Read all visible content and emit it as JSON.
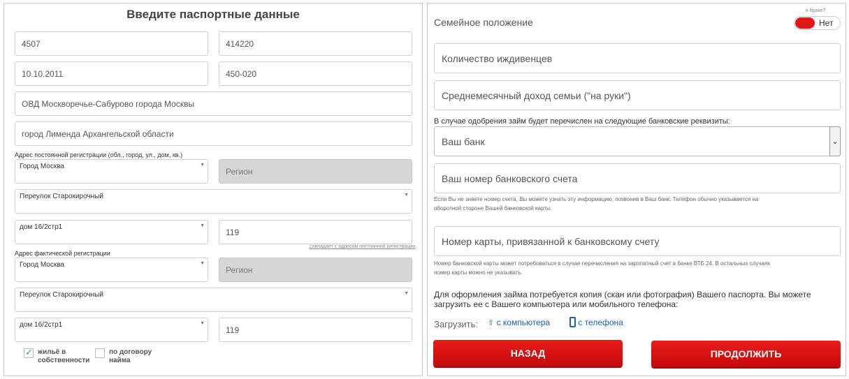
{
  "passport": {
    "title": "Введите паспортные данные",
    "series": "4507",
    "number": "414220",
    "issue_date": "10.10.2011",
    "division_code": "450-020",
    "issued_by": "ОВД Москворечье-Сабурово города Москвы",
    "birth_place": "город Лименда Архангельской области"
  },
  "permanent_address": {
    "label": "Адрес постоянной регистрации (обл., город, ул., дом, кв.)",
    "city": "Город Москва",
    "region_placeholder": "Регион",
    "street": "Переулок Старокирочный",
    "house": "дом 16/2стр1",
    "index": "119",
    "same_address_link": "совпадает с адресом постоянной регистрации"
  },
  "actual_address": {
    "label": "Адрес фактической регистрации",
    "city": "Город Москва",
    "region_placeholder": "Регион",
    "street": "Переулок Старокирочный",
    "house": "дом 16/2стр1",
    "index": "119"
  },
  "housing": {
    "owned_label_1": "жильё в",
    "owned_label_2": "собственности",
    "owned_checked": true,
    "lease_label_1": "по договору",
    "lease_label_2": "найма",
    "lease_checked": false
  },
  "family": {
    "label": "Семейное положение",
    "married_caption": "в браке?",
    "married_value": "Нет",
    "dependents_placeholder": "Количество иждивенцев",
    "income_placeholder": "Среднемесячный доход семьи (\"на руки\")"
  },
  "bank": {
    "intro": "В случае одобрения займ будет перечислен на следующие банковские реквизиты:",
    "bank_select": "Ваш банк",
    "account_placeholder": "Ваш номер банковского счета",
    "account_note_1": "Если Вы не знаете номер счета, Вы можете узнать эту информацию, позвонив в Ваш банк. Телефон обычно указывается на",
    "account_note_2": "оборотной стороне Вашей банковской карты.",
    "card_placeholder": "Номер карты, привязанной к банковскому счету",
    "card_note_1": "Номер банковской карты может потребоваться в случае перечисления на зарплатный счет в банке ВТБ 24. В остальных случаях",
    "card_note_2": "номер карты можно не указывать."
  },
  "upload": {
    "text_1": "Для оформления займа потребуется копия (скан или фотография) Вашего паспорта. Вы можете",
    "text_2": "загрузить ее с Вашего компьютера или мобильного телефона:",
    "label": "Загрузить:",
    "from_computer": "с компьютера",
    "from_phone": "с телефона"
  },
  "buttons": {
    "back": "НАЗАД",
    "continue": "ПРОДОЛЖИТЬ"
  },
  "colors": {
    "accent": "#d91010",
    "link": "#1a5fb4"
  }
}
